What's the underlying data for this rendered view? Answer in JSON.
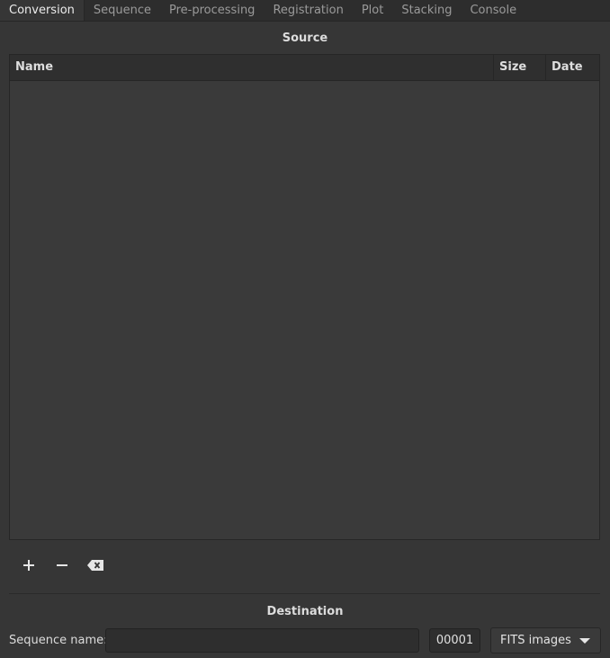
{
  "tabs": [
    {
      "label": "Conversion",
      "active": true
    },
    {
      "label": "Sequence",
      "active": false
    },
    {
      "label": "Pre-processing",
      "active": false
    },
    {
      "label": "Registration",
      "active": false
    },
    {
      "label": "Plot",
      "active": false
    },
    {
      "label": "Stacking",
      "active": false
    },
    {
      "label": "Console",
      "active": false
    }
  ],
  "source": {
    "title": "Source",
    "columns": {
      "name": "Name",
      "size": "Size",
      "date": "Date"
    },
    "rows": []
  },
  "tools": {
    "add_icon": "plus-icon",
    "remove_icon": "minus-icon",
    "clear_icon": "backspace-clear-icon"
  },
  "destination": {
    "title": "Destination",
    "sequence_name_label": "Sequence name:",
    "sequence_name_value": "",
    "index_value": "00001",
    "output_format": "FITS images"
  },
  "colors": {
    "background": "#363636",
    "tabbar": "#2d2d2d",
    "list_background": "#3a3a3a",
    "text": "#e6e6e6",
    "inactive_tab_text": "#9a9a9a"
  }
}
